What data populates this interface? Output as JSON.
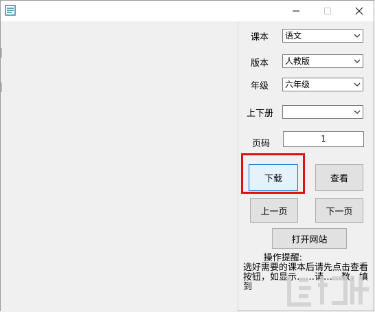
{
  "window": {
    "title": "",
    "controls": {
      "minimize": "—",
      "maximize": "☐",
      "close": "✕"
    }
  },
  "form": {
    "textbook_label": "课本",
    "textbook_value": "语文",
    "edition_label": "版本",
    "edition_value": "人教版",
    "grade_label": "年级",
    "grade_value": "六年级",
    "volume_label": "上下册",
    "volume_value": "",
    "page_label": "页码",
    "page_value": "1"
  },
  "buttons": {
    "download": "下载",
    "view": "查看",
    "prev_page": "上一页",
    "next_page": "下一页",
    "open_site": "打开网站"
  },
  "info": {
    "title": "操作提醒:",
    "body": "选好需要的课本后请先点击查看按钮，如显示……请……数，填到"
  },
  "colors": {
    "highlight": "#e01010",
    "focus_border": "#0078d7",
    "window_bg": "#f0f0f0"
  },
  "icons": {
    "app": "app-icon",
    "dropdown": "chevron-down-icon"
  }
}
